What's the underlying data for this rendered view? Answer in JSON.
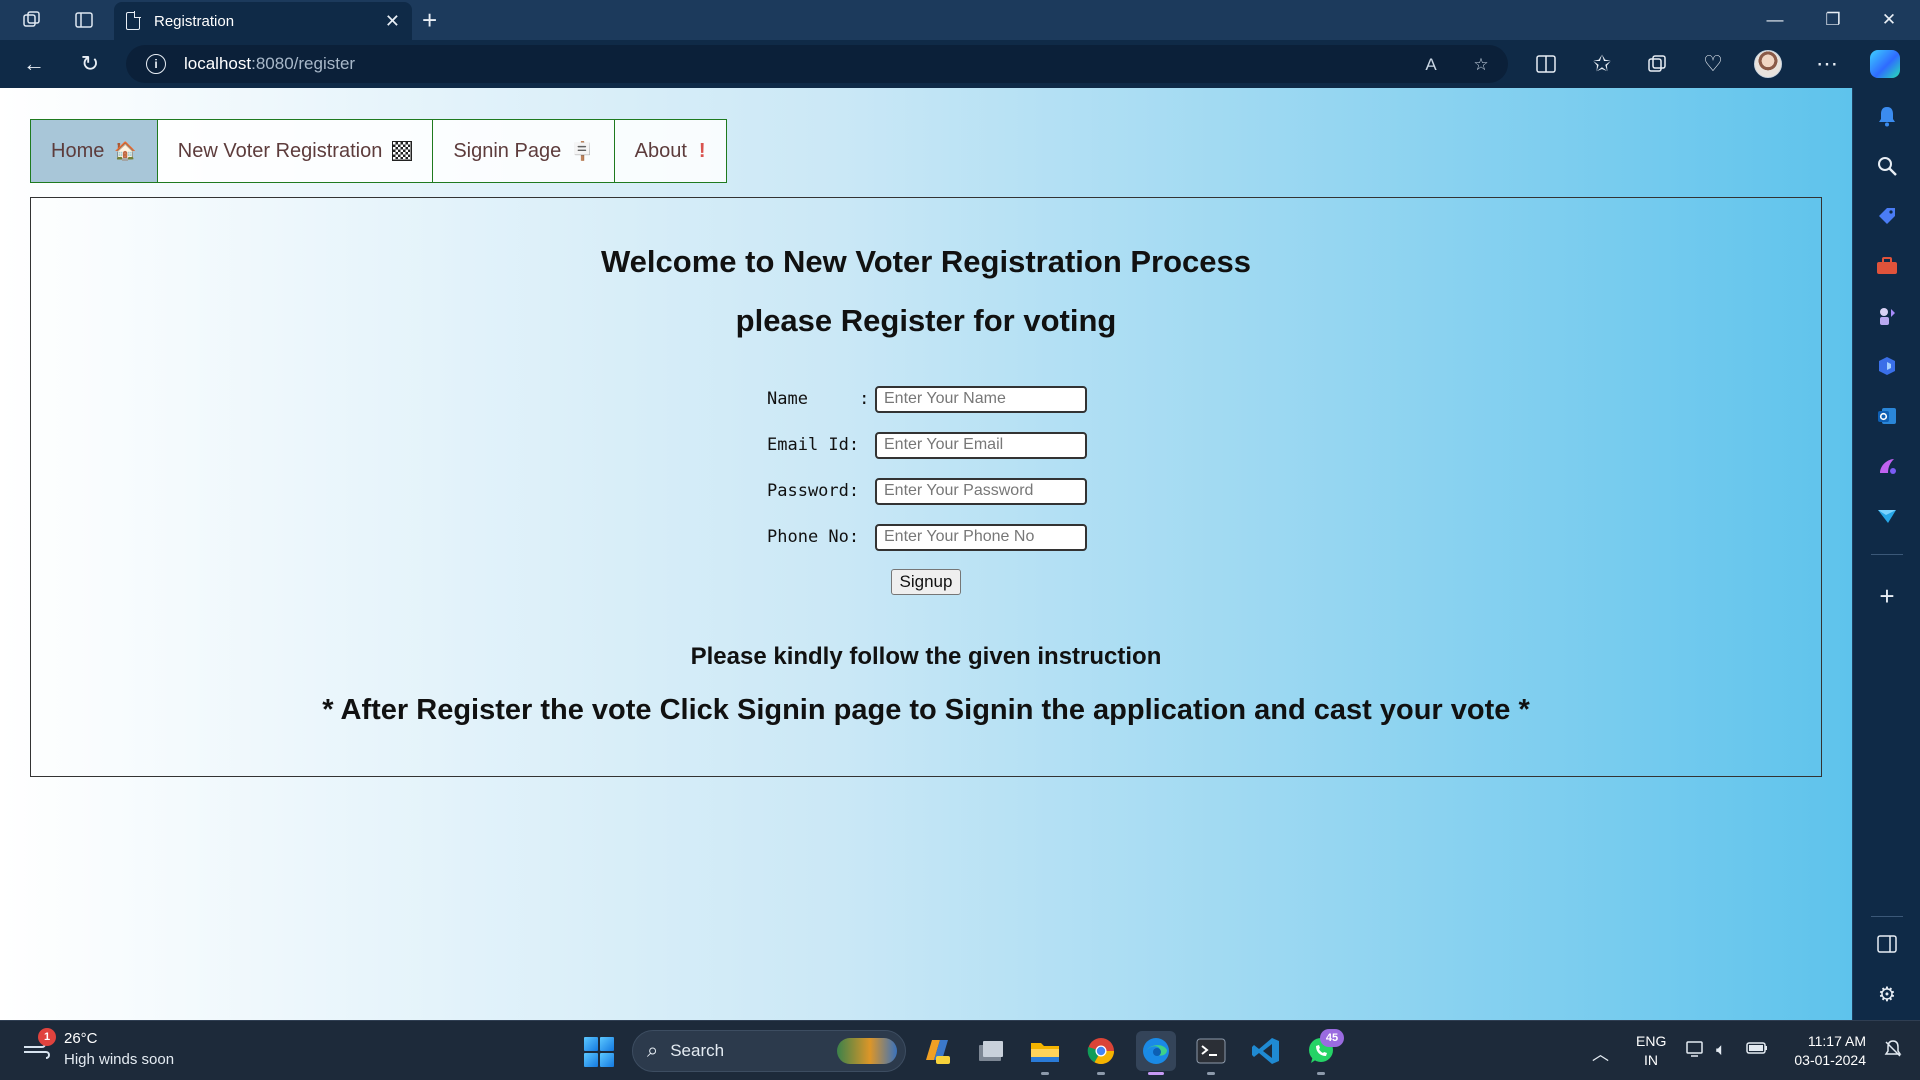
{
  "browser": {
    "tab_title": "Registration",
    "url_host": "localhost",
    "url_path": ":8080/register"
  },
  "nav": {
    "home": "Home",
    "home_emoji": "🏠",
    "new_voter": "New Voter Registration",
    "signin": "Signin Page",
    "signin_emoji": "🪧",
    "about": "About",
    "about_emoji": "!"
  },
  "main": {
    "heading": "Welcome to New Voter Registration Process",
    "subheading": "please Register for voting",
    "form": {
      "name_label": "Name     :",
      "name_placeholder": "Enter Your Name",
      "email_label": "Email Id:",
      "email_placeholder": "Enter Your Email",
      "password_label": "Password:",
      "password_placeholder": "Enter Your Password",
      "phone_label": "Phone No:",
      "phone_placeholder": "Enter Your Phone No",
      "submit_label": "Signup"
    },
    "instruction_title": "Please kindly follow the given instruction",
    "instruction_text": "* After Register the vote Click Signin page to Signin the application and cast your vote *"
  },
  "taskbar": {
    "weather_badge": "1",
    "weather_temp": "26°C",
    "weather_desc": "High winds soon",
    "search_label": "Search",
    "whatsapp_badge": "45",
    "lang_line1": "ENG",
    "lang_line2": "IN",
    "time": "11:17 AM",
    "date": "03-01-2024"
  },
  "colors": {
    "accent_green_border": "#1f7a1f",
    "browser_chrome": "#0f2a47",
    "page_gradient_end": "#5ec3ec"
  }
}
